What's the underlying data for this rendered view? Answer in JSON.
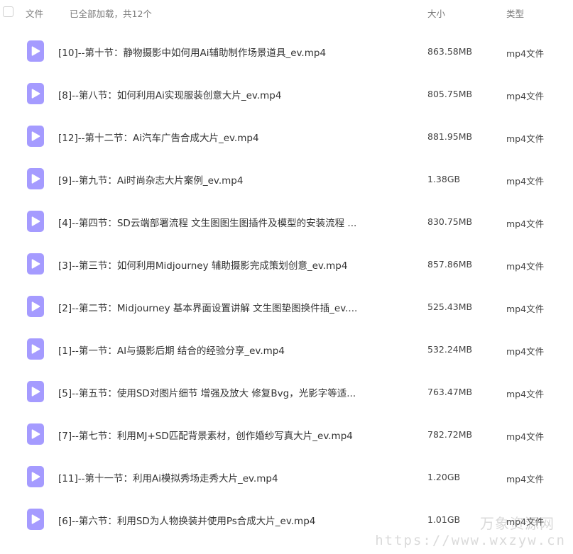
{
  "header": {
    "name_label": "文件",
    "status_text": "已全部加载，共12个",
    "size_label": "大小",
    "type_label": "类型"
  },
  "files": [
    {
      "name": "[10]--第十节：静物摄影中如何用Ai辅助制作场景道具_ev.mp4",
      "size": "863.58MB",
      "type": "mp4文件"
    },
    {
      "name": "[8]--第八节：如何利用Ai实现服装创意大片_ev.mp4",
      "size": "805.75MB",
      "type": "mp4文件"
    },
    {
      "name": "[12]--第十二节：Ai汽车广告合成大片_ev.mp4",
      "size": "881.95MB",
      "type": "mp4文件"
    },
    {
      "name": "[9]--第九节：Ai时尚杂志大片案例_ev.mp4",
      "size": "1.38GB",
      "type": "mp4文件"
    },
    {
      "name": "[4]--第四节：SD云端部署流程 文生图图生图插件及模型的安装流程 ...",
      "size": "830.75MB",
      "type": "mp4文件"
    },
    {
      "name": "[3]--第三节：如何利用Midjourney 辅助摄影完成策划创意_ev.mp4",
      "size": "857.86MB",
      "type": "mp4文件"
    },
    {
      "name": "[2]--第二节：Midjourney 基本界面设置讲解 文生图垫图换件插_ev....",
      "size": "525.43MB",
      "type": "mp4文件"
    },
    {
      "name": "[1]--第一节：AI与摄影后期 结合的经验分享_ev.mp4",
      "size": "532.24MB",
      "type": "mp4文件"
    },
    {
      "name": "[5]--第五节：使用SD对图片细节 增强及放大 修复Bvg，光影字等适...",
      "size": "763.47MB",
      "type": "mp4文件"
    },
    {
      "name": "[7]--第七节：利用MJ+SD匹配背景素材，创作婚纱写真大片_ev.mp4",
      "size": "782.72MB",
      "type": "mp4文件"
    },
    {
      "name": "[11]--第十一节：利用Ai模拟秀场走秀大片_ev.mp4",
      "size": "1.20GB",
      "type": "mp4文件"
    },
    {
      "name": "[6]--第六节：利用SD为人物换装并使用Ps合成大片_ev.mp4",
      "size": "1.01GB",
      "type": "mp4文件"
    }
  ],
  "icons": {
    "file": "video-file-icon",
    "file_color": "#a59bff"
  },
  "watermark": {
    "title": "万象资源网",
    "url": "https://www.wxzyw.cn"
  }
}
